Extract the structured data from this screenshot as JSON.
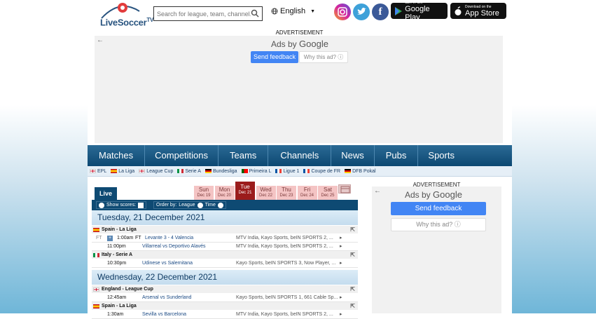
{
  "header": {
    "logo_text": "LiveSoccer",
    "logo_tv": "TV",
    "search_placeholder": "Search for league, team, channel...",
    "language": "English"
  },
  "social": [
    "instagram-icon",
    "twitter-icon",
    "facebook-icon"
  ],
  "stores": [
    {
      "small": "GET IT ON",
      "big": "Google Play"
    },
    {
      "small": "Download on the",
      "big": "App Store"
    }
  ],
  "top_ad": {
    "label": "ADVERTISEMENT",
    "ads_by": "Ads by",
    "google": "Google",
    "send_feedback": "Send feedback",
    "why": "Why this ad?"
  },
  "nav": [
    "Matches",
    "Competitions",
    "Teams",
    "Channels",
    "News",
    "Pubs",
    "Sports"
  ],
  "leagues": [
    {
      "name": "EPL",
      "flag": "eng"
    },
    {
      "name": "La Liga",
      "flag": "esp"
    },
    {
      "name": "League Cup",
      "flag": "eng"
    },
    {
      "name": "Serie A",
      "flag": "ita"
    },
    {
      "name": "Bundesliga",
      "flag": "ger"
    },
    {
      "name": "Primeira L",
      "flag": "por"
    },
    {
      "name": "Ligue 1",
      "flag": "fra"
    },
    {
      "name": "Coupe de FR",
      "flag": "fra"
    },
    {
      "name": "DFB Pokal",
      "flag": "ger"
    }
  ],
  "live_tab": "Live",
  "days": [
    {
      "day": "Sun",
      "date": "Dec 19"
    },
    {
      "day": "Mon",
      "date": "Dec 20"
    },
    {
      "day": "Tue",
      "date": "Dec 21"
    },
    {
      "day": "Wed",
      "date": "Dec 22"
    },
    {
      "day": "Thu",
      "date": "Dec 23"
    },
    {
      "day": "Fri",
      "date": "Dec 24"
    },
    {
      "day": "Sat",
      "date": "Dec 25"
    }
  ],
  "selected_day": "Tue",
  "toolbar": {
    "show_scores": "Show scores:",
    "order_by": "Order by:",
    "league": "League",
    "time": "Time"
  },
  "dates": [
    {
      "title": "Tuesday, 21 December 2021",
      "competitions": [
        {
          "name": "Spain - La Liga",
          "flag": "esp",
          "matches": [
            {
              "status": "FT",
              "time": "1:00am",
              "ft": "FT",
              "match": "Levante 3 - 4 Valencia",
              "channels": "MTV India, Kayo Sports, beIN SPORTS 2, ..."
            },
            {
              "status": "",
              "time": "11:00pm",
              "ft": "",
              "match": "Villarreal vs Deportivo Alavés",
              "channels": "MTV India, Kayo Sports, beIN SPORTS 2, ..."
            }
          ]
        },
        {
          "name": "Italy - Serie A",
          "flag": "ita",
          "matches": [
            {
              "status": "",
              "time": "10:30pm",
              "ft": "",
              "match": "Udinese vs Salernitana",
              "channels": "Kayo Sports, beIN SPORTS 3, Now Player, ..."
            }
          ]
        }
      ]
    },
    {
      "title": "Wednesday, 22 December 2021",
      "competitions": [
        {
          "name": "England - League Cup",
          "flag": "eng",
          "matches": [
            {
              "status": "",
              "time": "12:45am",
              "ft": "",
              "match": "Arsenal vs Sunderland",
              "channels": "Kayo Sports, beIN SPORTS 1, 661 Cable Sp..."
            }
          ]
        },
        {
          "name": "Spain - La Liga",
          "flag": "esp",
          "matches": [
            {
              "status": "",
              "time": "1:30am",
              "ft": "",
              "match": "Sevilla vs Barcelona",
              "channels": "MTV India, Kayo Sports, beIN SPORTS 2, ..."
            }
          ]
        }
      ]
    }
  ],
  "right_ad": {
    "label": "ADVERTISEMENT",
    "ads_by": "Ads by",
    "google": "Google",
    "send_feedback": "Send feedback",
    "why": "Why this ad?"
  },
  "colors": {
    "nav": "#0c4872",
    "selected_day": "#9b1c1c",
    "day": "#f4c4c4",
    "feedback": "#4285f4"
  }
}
